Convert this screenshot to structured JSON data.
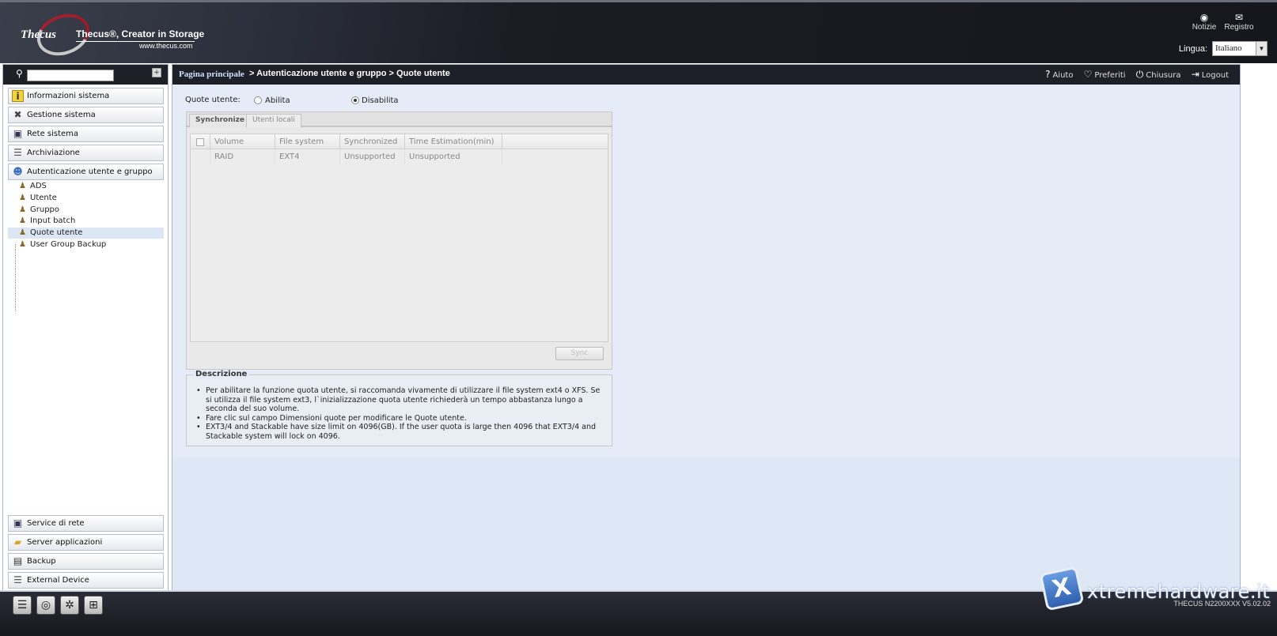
{
  "header": {
    "logo_text": "Thecus",
    "tagline": "Thecus®, Creator in Storage",
    "tagline_url": "www.thecus.com",
    "icons": [
      {
        "name": "rss-icon",
        "label": "Notizie"
      },
      {
        "name": "chat-icon",
        "label": "Registro"
      }
    ],
    "language_label": "Lingua:",
    "language_value": "Italiano"
  },
  "sidebar": {
    "search_placeholder": "",
    "categories_top": [
      {
        "label": "Informazioni sistema",
        "icon": "info-icon"
      },
      {
        "label": "Gestione sistema",
        "icon": "tools-icon"
      },
      {
        "label": "Rete sistema",
        "icon": "network-icon"
      },
      {
        "label": "Archiviazione",
        "icon": "storage-icon"
      },
      {
        "label": "Autenticazione utente e gruppo",
        "icon": "users-icon"
      }
    ],
    "sub_items": [
      {
        "label": "ADS"
      },
      {
        "label": "Utente"
      },
      {
        "label": "Gruppo"
      },
      {
        "label": "Input batch"
      },
      {
        "label": "Quote utente"
      },
      {
        "label": "User Group Backup"
      }
    ],
    "categories_bottom": [
      {
        "label": "Service di rete",
        "icon": "network-service-icon"
      },
      {
        "label": "Server applicazioni",
        "icon": "folder-icon"
      },
      {
        "label": "Backup",
        "icon": "backup-icon"
      },
      {
        "label": "External Device",
        "icon": "device-icon"
      }
    ]
  },
  "breadcrumb": {
    "home": "Pagina principale",
    "rest": "> Autenticazione utente e gruppo > Quote utente"
  },
  "top_links": [
    {
      "label": "Aiuto",
      "icon": "help-icon"
    },
    {
      "label": "Preferiti",
      "icon": "heart-icon"
    },
    {
      "label": "Chiusura",
      "icon": "power-icon"
    },
    {
      "label": "Logout",
      "icon": "logout-icon"
    }
  ],
  "quota": {
    "label": "Quote utente:",
    "option_enable": "Abilita",
    "option_disable": "Disabilita",
    "selected": "Disabilita"
  },
  "tabs": [
    {
      "label": "Synchronize",
      "active": true
    },
    {
      "label": "Utenti locali",
      "active": false
    }
  ],
  "grid": {
    "columns": [
      "Volume",
      "File system",
      "Synchronized",
      "Time Estimation(min)"
    ],
    "rows": [
      [
        "RAID",
        "EXT4",
        "Unsupported",
        "Unsupported"
      ]
    ],
    "sync_button": "Sync"
  },
  "description": {
    "title": "Descrizione",
    "items": [
      "Per abilitare la funzione quota utente, si raccomanda vivamente di utilizzare il file system ext4 o XFS. Se si utilizza il file system ext3, l`inizializzazione quota utente richiederà un tempo abbastanza lungo a seconda del suo volume.",
      "Fare clic sul campo Dimensioni quote per modificare le Quote utente.",
      "EXT3/4 and Stackable have size limit on 4096(GB). If the user quota is large then 4096 that EXT3/4 and Stackable system will lock on 4096."
    ]
  },
  "taskbar": {
    "icons": [
      "server-icon",
      "disk-icon",
      "fan-icon",
      "network-icon"
    ],
    "version": "THECUS N2200XXX V5.02.02"
  },
  "watermark": {
    "text": "xtremehardware.it",
    "logo": "X"
  }
}
